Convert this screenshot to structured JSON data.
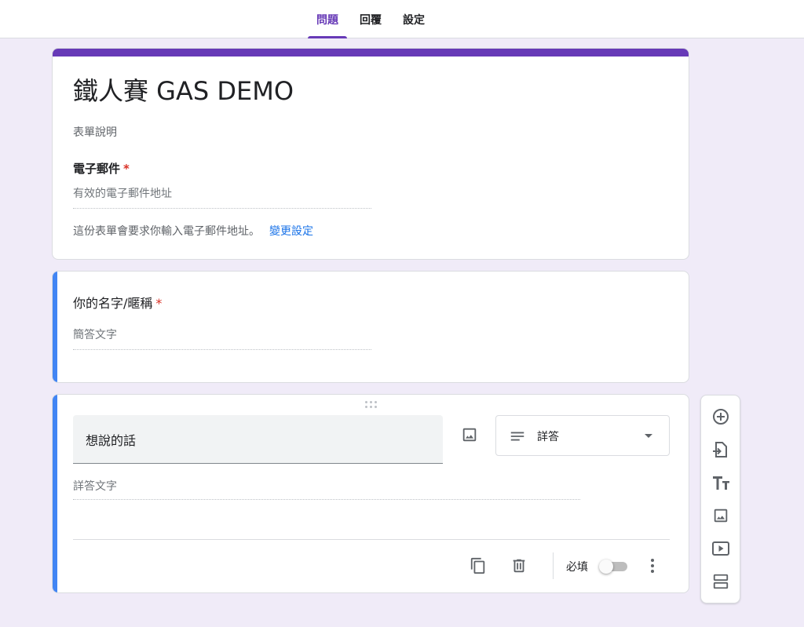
{
  "tabs": [
    {
      "label": "問題",
      "active": true
    },
    {
      "label": "回覆",
      "active": false
    },
    {
      "label": "設定",
      "active": false
    }
  ],
  "header_card": {
    "title": "鐵人賽 GAS DEMO",
    "description": "表單說明",
    "email_question": {
      "label": "電子郵件",
      "required_mark": "*",
      "placeholder": "有效的電子郵件地址"
    },
    "email_note": "這份表單會要求你輸入電子郵件地址。",
    "email_note_link": "變更設定"
  },
  "question_name": {
    "label": "你的名字/暱稱",
    "required_mark": "*",
    "placeholder": "簡答文字"
  },
  "active_question": {
    "title": "想說的話",
    "type_label": "詳答",
    "answer_placeholder": "詳答文字",
    "required_label": "必填",
    "required_on": false
  },
  "side_toolbar": {
    "icons": [
      "add-question-icon",
      "import-questions-icon",
      "add-title-icon",
      "add-image-icon",
      "add-video-icon",
      "add-section-icon"
    ]
  },
  "colors": {
    "theme": "#673ab7",
    "active_bar": "#4285f4",
    "background": "#f0ebf8",
    "required": "#d93025",
    "link": "#1a73e8"
  }
}
